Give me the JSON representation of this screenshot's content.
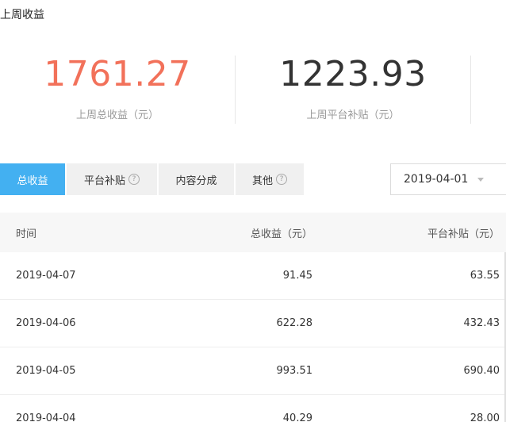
{
  "section_title": "上周收益",
  "stats": [
    {
      "value": "1761.27",
      "label": "上周总收益（元）"
    },
    {
      "value": "1223.93",
      "label": "上周平台补贴（元）"
    }
  ],
  "tabs": [
    {
      "label": "总收益",
      "active": true,
      "help": false
    },
    {
      "label": "平台补贴",
      "active": false,
      "help": true
    },
    {
      "label": "内容分成",
      "active": false,
      "help": false
    },
    {
      "label": "其他",
      "active": false,
      "help": true
    }
  ],
  "help_glyph": "?",
  "date_select": {
    "value": "2019-04-01"
  },
  "table": {
    "headers": [
      "时间",
      "总收益（元）",
      "平台补贴（元）"
    ],
    "rows": [
      [
        "2019-04-07",
        "91.45",
        "63.55"
      ],
      [
        "2019-04-06",
        "622.28",
        "432.43"
      ],
      [
        "2019-04-05",
        "993.51",
        "690.40"
      ],
      [
        "2019-04-04",
        "40.29",
        "28.00"
      ]
    ]
  },
  "colors": {
    "accent": "#43b0f1",
    "total_value": "#f2715a"
  }
}
